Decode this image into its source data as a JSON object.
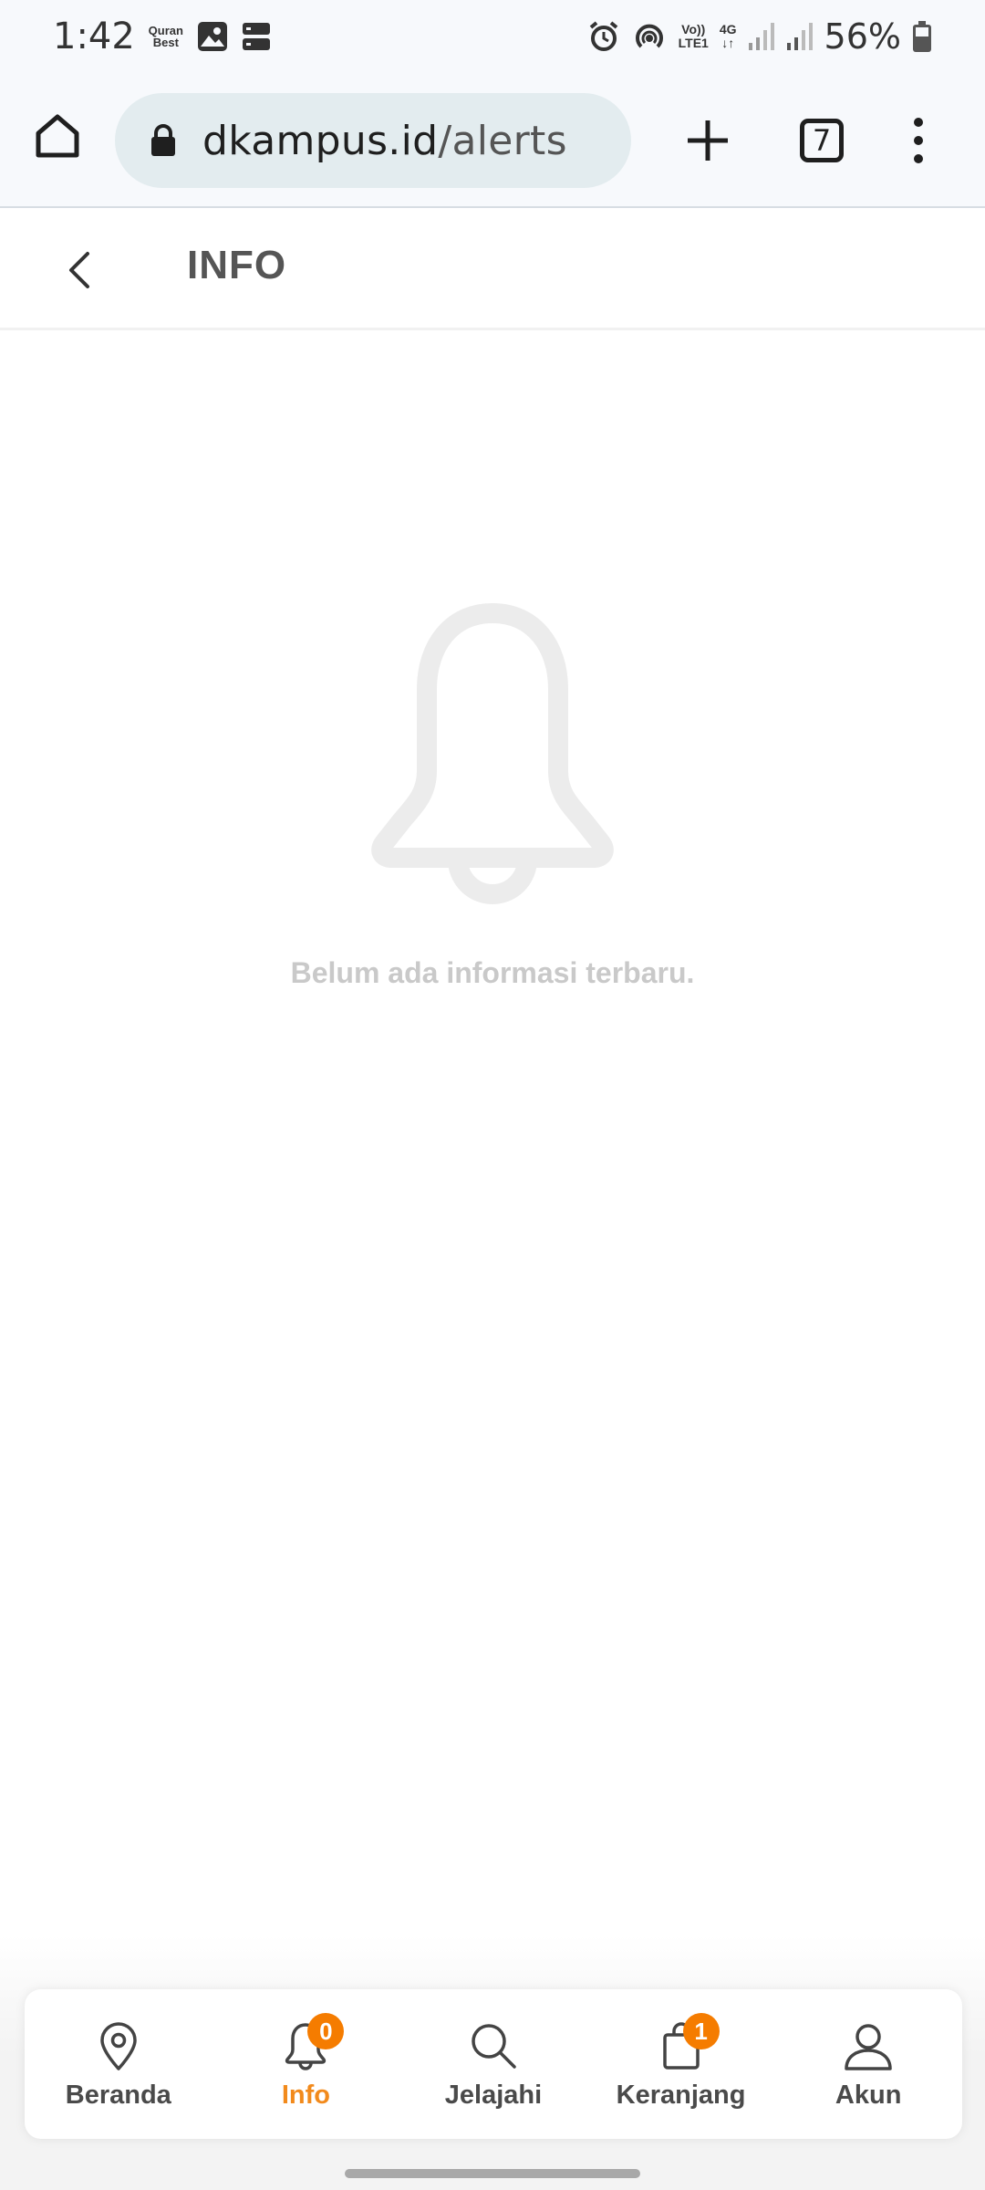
{
  "status_bar": {
    "time": "1:42",
    "app_label_line1": "Quran",
    "app_label_line2": "Best",
    "network_label_volte_top": "Vo))",
    "network_label_volte_bottom": "LTE1",
    "network_label_4g_top": "4G",
    "network_label_4g_bottom": "↓↑",
    "battery_percent": "56%"
  },
  "browser": {
    "url_domain": "dkampus.id",
    "url_path": "/alerts",
    "tab_count": "7"
  },
  "header": {
    "title": "INFO"
  },
  "empty_state": {
    "message": "Belum ada informasi terbaru."
  },
  "bottom_nav": {
    "items": [
      {
        "label": "Beranda",
        "icon": "location-pin-icon"
      },
      {
        "label": "Info",
        "icon": "bell-icon",
        "badge": "0",
        "active": true
      },
      {
        "label": "Jelajahi",
        "icon": "search-icon"
      },
      {
        "label": "Keranjang",
        "icon": "bag-icon",
        "badge": "1"
      },
      {
        "label": "Akun",
        "icon": "user-icon"
      }
    ]
  },
  "colors": {
    "accent": "#f28a1c",
    "badge": "#f57c00",
    "empty_icon": "#ececec",
    "empty_text": "#c9c9c9"
  }
}
